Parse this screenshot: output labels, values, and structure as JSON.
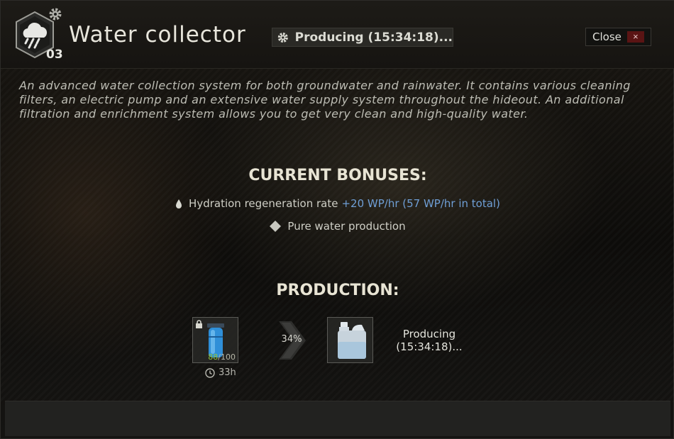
{
  "header": {
    "title": "Water collector",
    "level": "03",
    "status": "Producing (15:34:18)...",
    "close_label": "Close",
    "close_icon": "×"
  },
  "description": "An advanced water collection system for both groundwater and rainwater. It contains various cleaning filters, an electric pump and an extensive water supply system throughout the hideout. An additional filtration and enrichment system allows you to get very clean and high-quality water.",
  "bonuses": {
    "title": "CURRENT BONUSES:",
    "items": [
      {
        "icon": "water-drop-icon",
        "label": "Hydration regeneration rate",
        "value": "+20 WP/hr (57 WP/hr in total)"
      },
      {
        "icon": "diamond-icon",
        "label": "Pure water production",
        "value": ""
      }
    ]
  },
  "production": {
    "title": "PRODUCTION:",
    "input": {
      "icon": "water-filter-icon",
      "count": "88",
      "max": "/100",
      "time": "33h"
    },
    "progress": "34%",
    "progress_fraction": 0.34,
    "output": {
      "icon": "water-canister-icon"
    },
    "status_line1": "Producing",
    "status_line2": "(15:34:18)..."
  },
  "colors": {
    "accent_blue": "#6f9fd6",
    "count_green": "#96c43a",
    "close_red": "#5a1414"
  }
}
